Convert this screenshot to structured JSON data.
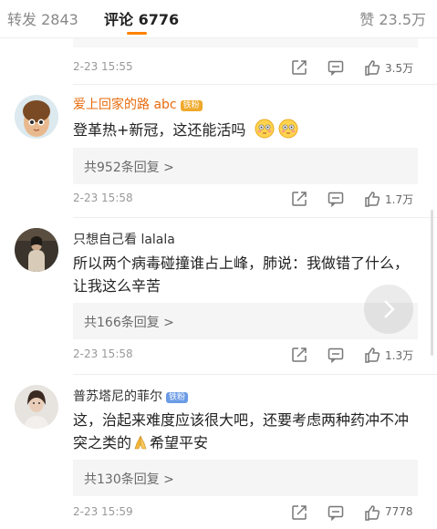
{
  "tabs": {
    "repost_label": "转发 2843",
    "comment_label": "评论 6776",
    "like_label": "赞 23.5万"
  },
  "colors": {
    "accent": "#ff8200",
    "vip_name": "#e86b0c",
    "reply_box_bg": "#f5f5f5"
  },
  "top_meta": {
    "time": "2-23 15:55",
    "likes": "3.5万"
  },
  "comments": [
    {
      "username": "爱上回家的路 abc",
      "badge": "铁粉",
      "text": "登革热+新冠，这还能活吗",
      "emoji": [
        "flushed-face-emoji",
        "flushed-face-emoji"
      ],
      "replies": "共952条回复 >",
      "time": "2-23 15:58",
      "likes": "1.7万"
    },
    {
      "username": "只想自己看 lalala",
      "text": "所以两个病毒碰撞谁占上峰，肺说：我做错了什么，让我这么辛苦",
      "replies": "共166条回复 >",
      "time": "2-23 15:58",
      "likes": "1.3万"
    },
    {
      "username": "普苏塔尼的菲尔",
      "badge": "铁粉",
      "text_part1": "这，治起来难度应该很大吧，还要考虑两种药冲不冲突之类的",
      "text_part2": "希望平安",
      "emoji": [
        "folded-hands-emoji"
      ],
      "replies": "共130条回复 >",
      "time": "2-23 15:59",
      "likes": "7778"
    }
  ],
  "icons": {
    "share": "share-icon",
    "comment": "comment-icon",
    "like": "thumbs-up-icon",
    "float": "chevron-right-icon"
  }
}
